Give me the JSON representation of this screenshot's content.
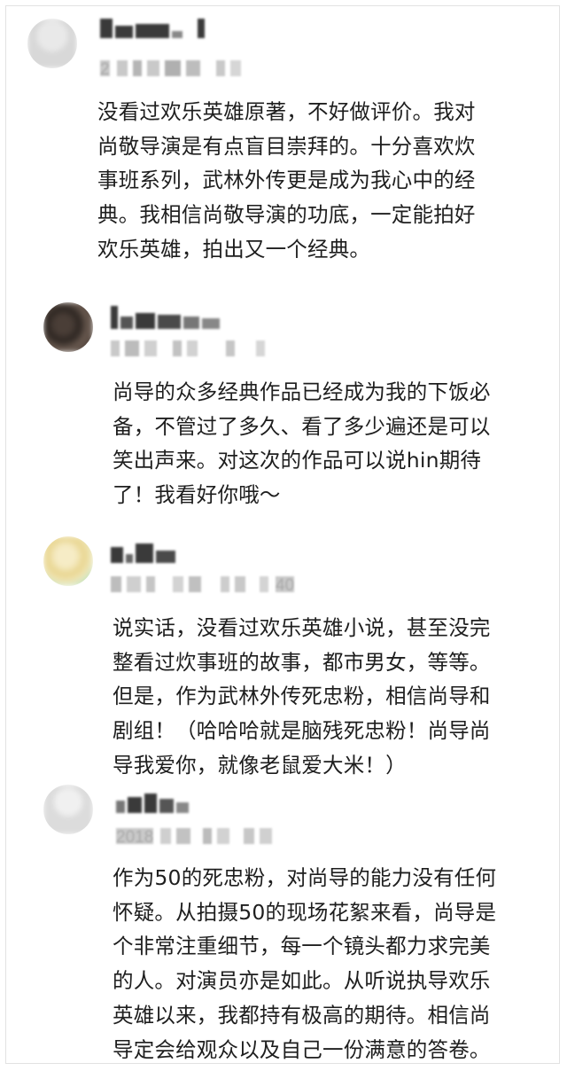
{
  "comments": [
    {
      "meta_prefix": "2",
      "meta_suffix": "",
      "text": "没看过欢乐英雄原著，不好做评价。我对\n尚敬导演是有点盲目崇拜的。十分喜欢炊\n事班系列，武林外传更是成为我心中的经\n典。我相信尚敬导演的功底，一定能拍好\n欢乐英雄，拍出又一个经典。"
    },
    {
      "meta_prefix": "",
      "meta_suffix": "",
      "text": "尚导的众多经典作品已经成为我的下饭必\n备，不管过了多久、看了多少遍还是可以\n笑出声来。对这次的作品可以说hin期待\n了！我看好你哦～"
    },
    {
      "meta_prefix": "",
      "meta_suffix": "40",
      "text": "说实话，没看过欢乐英雄小说，甚至没完\n整看过炊事班的故事，都市男女，等等。\n但是，作为武林外传死忠粉，相信尚导和\n剧组！（哈哈哈就是脑残死忠粉！尚导尚\n导我爱你，就像老鼠爱大米！）"
    },
    {
      "meta_prefix": "2018",
      "meta_suffix": "",
      "text": "作为50的死忠粉，对尚导的能力没有任何\n怀疑。从拍摄50的现场花絮来看，尚导是\n个非常注重细节，每一个镜头都力求完美\n的人。对演员亦是如此。从听说执导欢乐\n英雄以来，我都持有极高的期待。相信尚\n导定会给观众以及自己一份满意的答卷。"
    }
  ]
}
